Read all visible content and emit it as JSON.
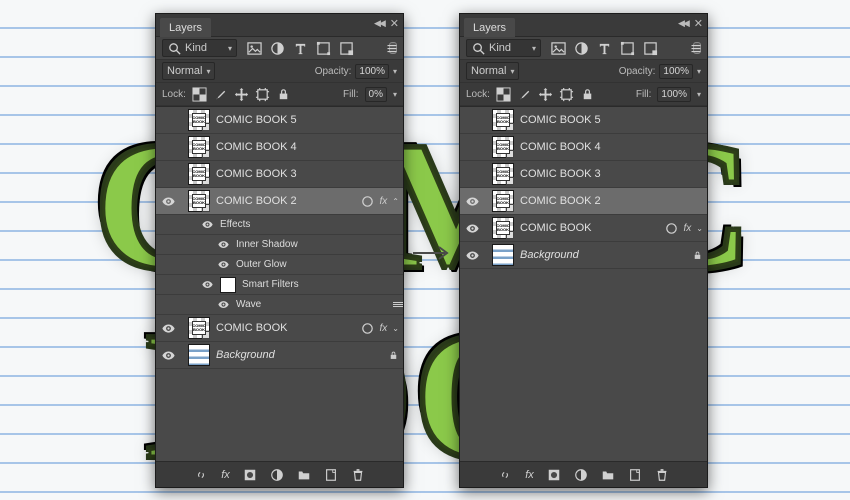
{
  "panel_title": "Layers",
  "filter": {
    "search_placeholder": "Kind"
  },
  "blend": {
    "mode": "Normal",
    "opacity_label": "Opacity:",
    "opacity_value": "100%"
  },
  "lock": {
    "label": "Lock:",
    "fill_label": "Fill:"
  },
  "left": {
    "fill_value": "0%",
    "layers": [
      {
        "name": "COMIC BOOK 5",
        "visible": false
      },
      {
        "name": "COMIC BOOK 4",
        "visible": false
      },
      {
        "name": "COMIC BOOK 3",
        "visible": false
      },
      {
        "name": "COMIC BOOK 2",
        "visible": true,
        "selected": true,
        "fx": true,
        "expanded": true,
        "effects_label": "Effects",
        "effects": [
          "Inner Shadow",
          "Outer Glow"
        ],
        "smart_filters_label": "Smart Filters",
        "smart_filters": [
          "Wave"
        ]
      },
      {
        "name": "COMIC BOOK",
        "visible": true,
        "fx": true
      },
      {
        "name": "Background",
        "visible": true,
        "italic": true,
        "locked": true,
        "bg": true
      }
    ]
  },
  "right": {
    "fill_value": "100%",
    "layers": [
      {
        "name": "COMIC BOOK 5",
        "visible": false
      },
      {
        "name": "COMIC BOOK 4",
        "visible": false
      },
      {
        "name": "COMIC BOOK 3",
        "visible": false
      },
      {
        "name": "COMIC BOOK 2",
        "visible": true,
        "selected": true
      },
      {
        "name": "COMIC BOOK",
        "visible": true,
        "fx": true
      },
      {
        "name": "Background",
        "visible": true,
        "italic": true,
        "locked": true,
        "bg": true
      }
    ]
  }
}
